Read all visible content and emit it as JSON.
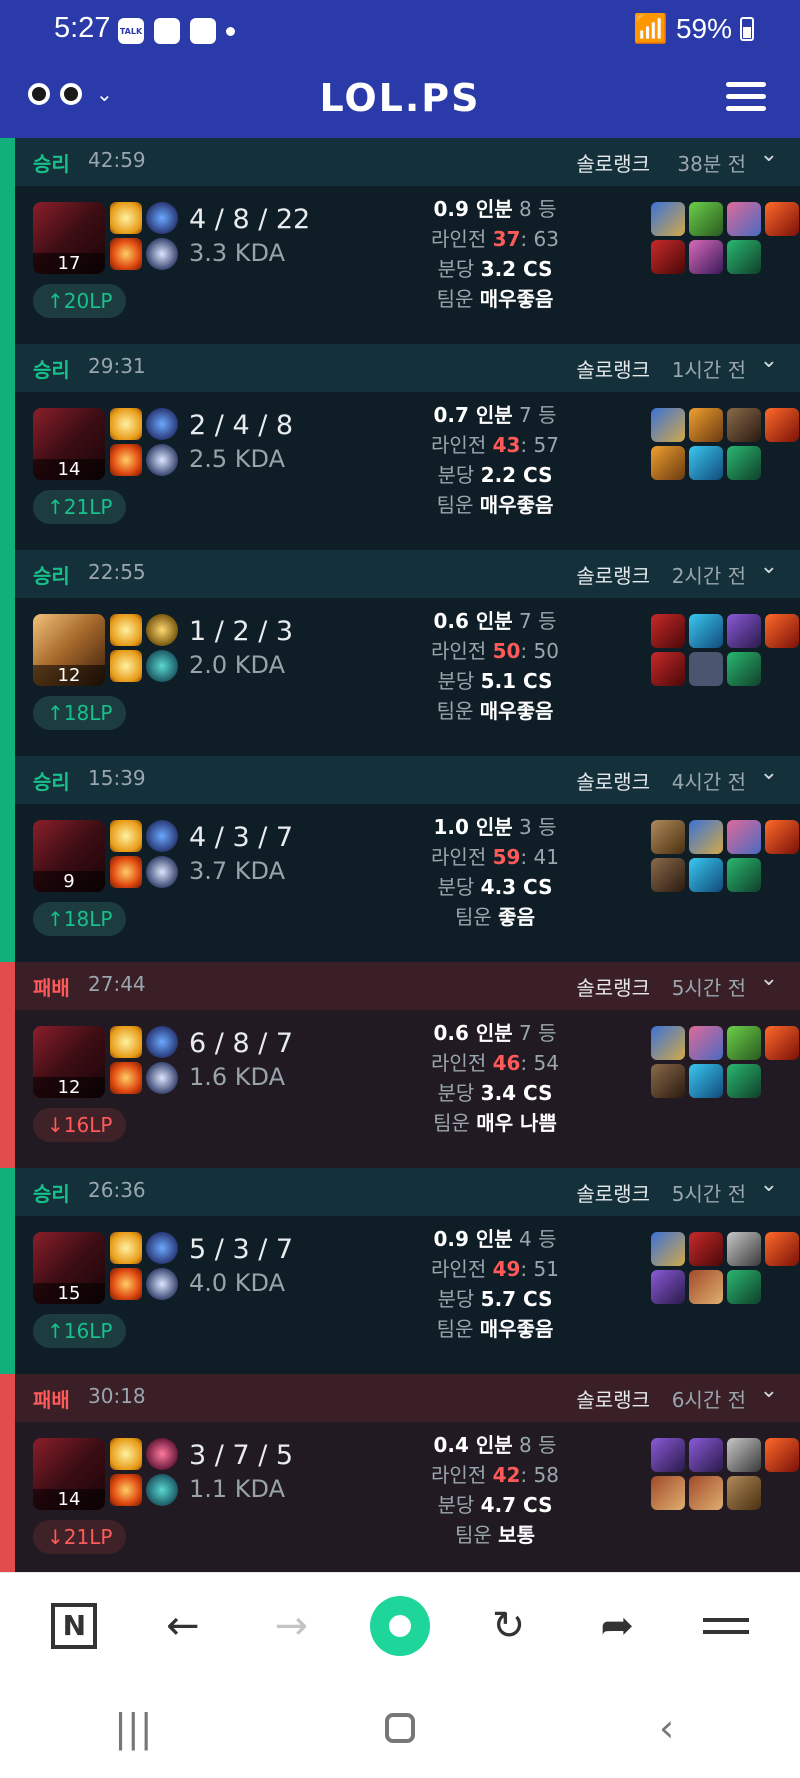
{
  "status_bar": {
    "time": "5:27",
    "talk_icon_text": "TALK",
    "battery": "59%"
  },
  "header": {
    "logo": "LOL.PS"
  },
  "matches": [
    {
      "result": "승리",
      "duration": "42:59",
      "queue": "솔로랭크",
      "ago": "38분 전",
      "level": "17",
      "kda": "4 / 8 / 22",
      "kda_ratio": "3.3 KDA",
      "lp": "↑20LP",
      "kp": "0.9 인분",
      "rank": "8 등",
      "lane_label": "라인전",
      "lane_mine": "37",
      "lane_opp": ": 63",
      "cs_label": "분당",
      "cs": "3.2 CS",
      "luck_label": "팀운",
      "luck": "매우좋음"
    },
    {
      "result": "승리",
      "duration": "29:31",
      "queue": "솔로랭크",
      "ago": "1시간 전",
      "level": "14",
      "kda": "2 / 4 / 8",
      "kda_ratio": "2.5 KDA",
      "lp": "↑21LP",
      "kp": "0.7 인분",
      "rank": "7 등",
      "lane_label": "라인전",
      "lane_mine": "43",
      "lane_opp": ": 57",
      "cs_label": "분당",
      "cs": "2.2 CS",
      "luck_label": "팀운",
      "luck": "매우좋음"
    },
    {
      "result": "승리",
      "duration": "22:55",
      "queue": "솔로랭크",
      "ago": "2시간 전",
      "level": "12",
      "kda": "1 / 2 / 3",
      "kda_ratio": "2.0 KDA",
      "lp": "↑18LP",
      "kp": "0.6 인분",
      "rank": "7 등",
      "lane_label": "라인전",
      "lane_mine": "50",
      "lane_opp": ": 50",
      "cs_label": "분당",
      "cs": "5.1 CS",
      "luck_label": "팀운",
      "luck": "매우좋음"
    },
    {
      "result": "승리",
      "duration": "15:39",
      "queue": "솔로랭크",
      "ago": "4시간 전",
      "level": "9",
      "kda": "4 / 3 / 7",
      "kda_ratio": "3.7 KDA",
      "lp": "↑18LP",
      "kp": "1.0 인분",
      "rank": "3 등",
      "lane_label": "라인전",
      "lane_mine": "59",
      "lane_opp": ": 41",
      "cs_label": "분당",
      "cs": "4.3 CS",
      "luck_label": "팀운",
      "luck": "좋음"
    },
    {
      "result": "패배",
      "duration": "27:44",
      "queue": "솔로랭크",
      "ago": "5시간 전",
      "level": "12",
      "kda": "6 / 8 / 7",
      "kda_ratio": "1.6 KDA",
      "lp": "↓16LP",
      "kp": "0.6 인분",
      "rank": "7 등",
      "lane_label": "라인전",
      "lane_mine": "46",
      "lane_opp": ": 54",
      "cs_label": "분당",
      "cs": "3.4 CS",
      "luck_label": "팀운",
      "luck": "매우 나쁨"
    },
    {
      "result": "승리",
      "duration": "26:36",
      "queue": "솔로랭크",
      "ago": "5시간 전",
      "level": "15",
      "kda": "5 / 3 / 7",
      "kda_ratio": "4.0 KDA",
      "lp": "↑16LP",
      "kp": "0.9 인분",
      "rank": "4 등",
      "lane_label": "라인전",
      "lane_mine": "49",
      "lane_opp": ": 51",
      "cs_label": "분당",
      "cs": "5.7 CS",
      "luck_label": "팀운",
      "luck": "매우좋음"
    },
    {
      "result": "패배",
      "duration": "30:18",
      "queue": "솔로랭크",
      "ago": "6시간 전",
      "level": "14",
      "kda": "3 / 7 / 5",
      "kda_ratio": "1.1 KDA",
      "lp": "↓21LP",
      "kp": "0.4 인분",
      "rank": "8 등",
      "lane_label": "라인전",
      "lane_mine": "42",
      "lane_opp": ": 58",
      "cs_label": "분당",
      "cs": "4.7 CS",
      "luck_label": "팀운",
      "luck": "보통"
    }
  ],
  "browser_bar": {
    "n_icon_text": "N"
  },
  "colors": {
    "header_bg": "#2a3aa8",
    "win": "#11b07a",
    "loss": "#e24c4c",
    "lane_highlight": "#ff5a5a"
  }
}
